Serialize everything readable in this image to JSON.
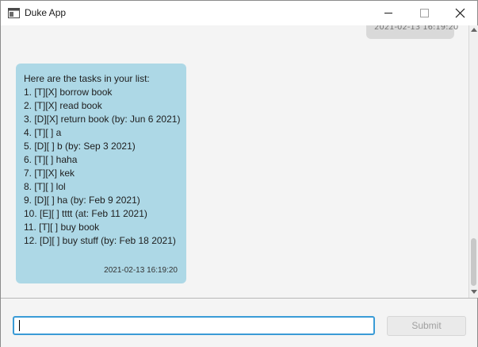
{
  "window": {
    "title": "Duke App"
  },
  "chat": {
    "user_message": {
      "timestamp": "2021-02-13 16:19:20"
    },
    "duke_message": {
      "lines": [
        "Here are the tasks in your list:",
        "1. [T][X] borrow book",
        "2. [T][X] read book",
        "3. [D][X] return book (by: Jun 6 2021)",
        "4. [T][ ] a",
        "5. [D][ ] b (by: Sep 3 2021)",
        "6. [T][ ] haha",
        "7. [T][X] kek",
        "8. [T][ ] lol",
        "9. [D][ ] ha (by: Feb 9 2021)",
        "10. [E][ ] tttt (at: Feb 11 2021)",
        "11. [T][ ] buy book",
        "12. [D][ ] buy stuff (by: Feb 18 2021)"
      ],
      "timestamp": "2021-02-13 16:19:20"
    }
  },
  "input": {
    "value": "",
    "send_label": "Submit"
  },
  "colors": {
    "duke_bubble": "#add8e6",
    "user_bubble": "#d9d9d9",
    "input_focus": "#3a9bd6"
  },
  "icons": {
    "app": "window-app-icon",
    "minimize": "minimize-icon",
    "maximize": "maximize-icon",
    "close": "close-icon"
  }
}
